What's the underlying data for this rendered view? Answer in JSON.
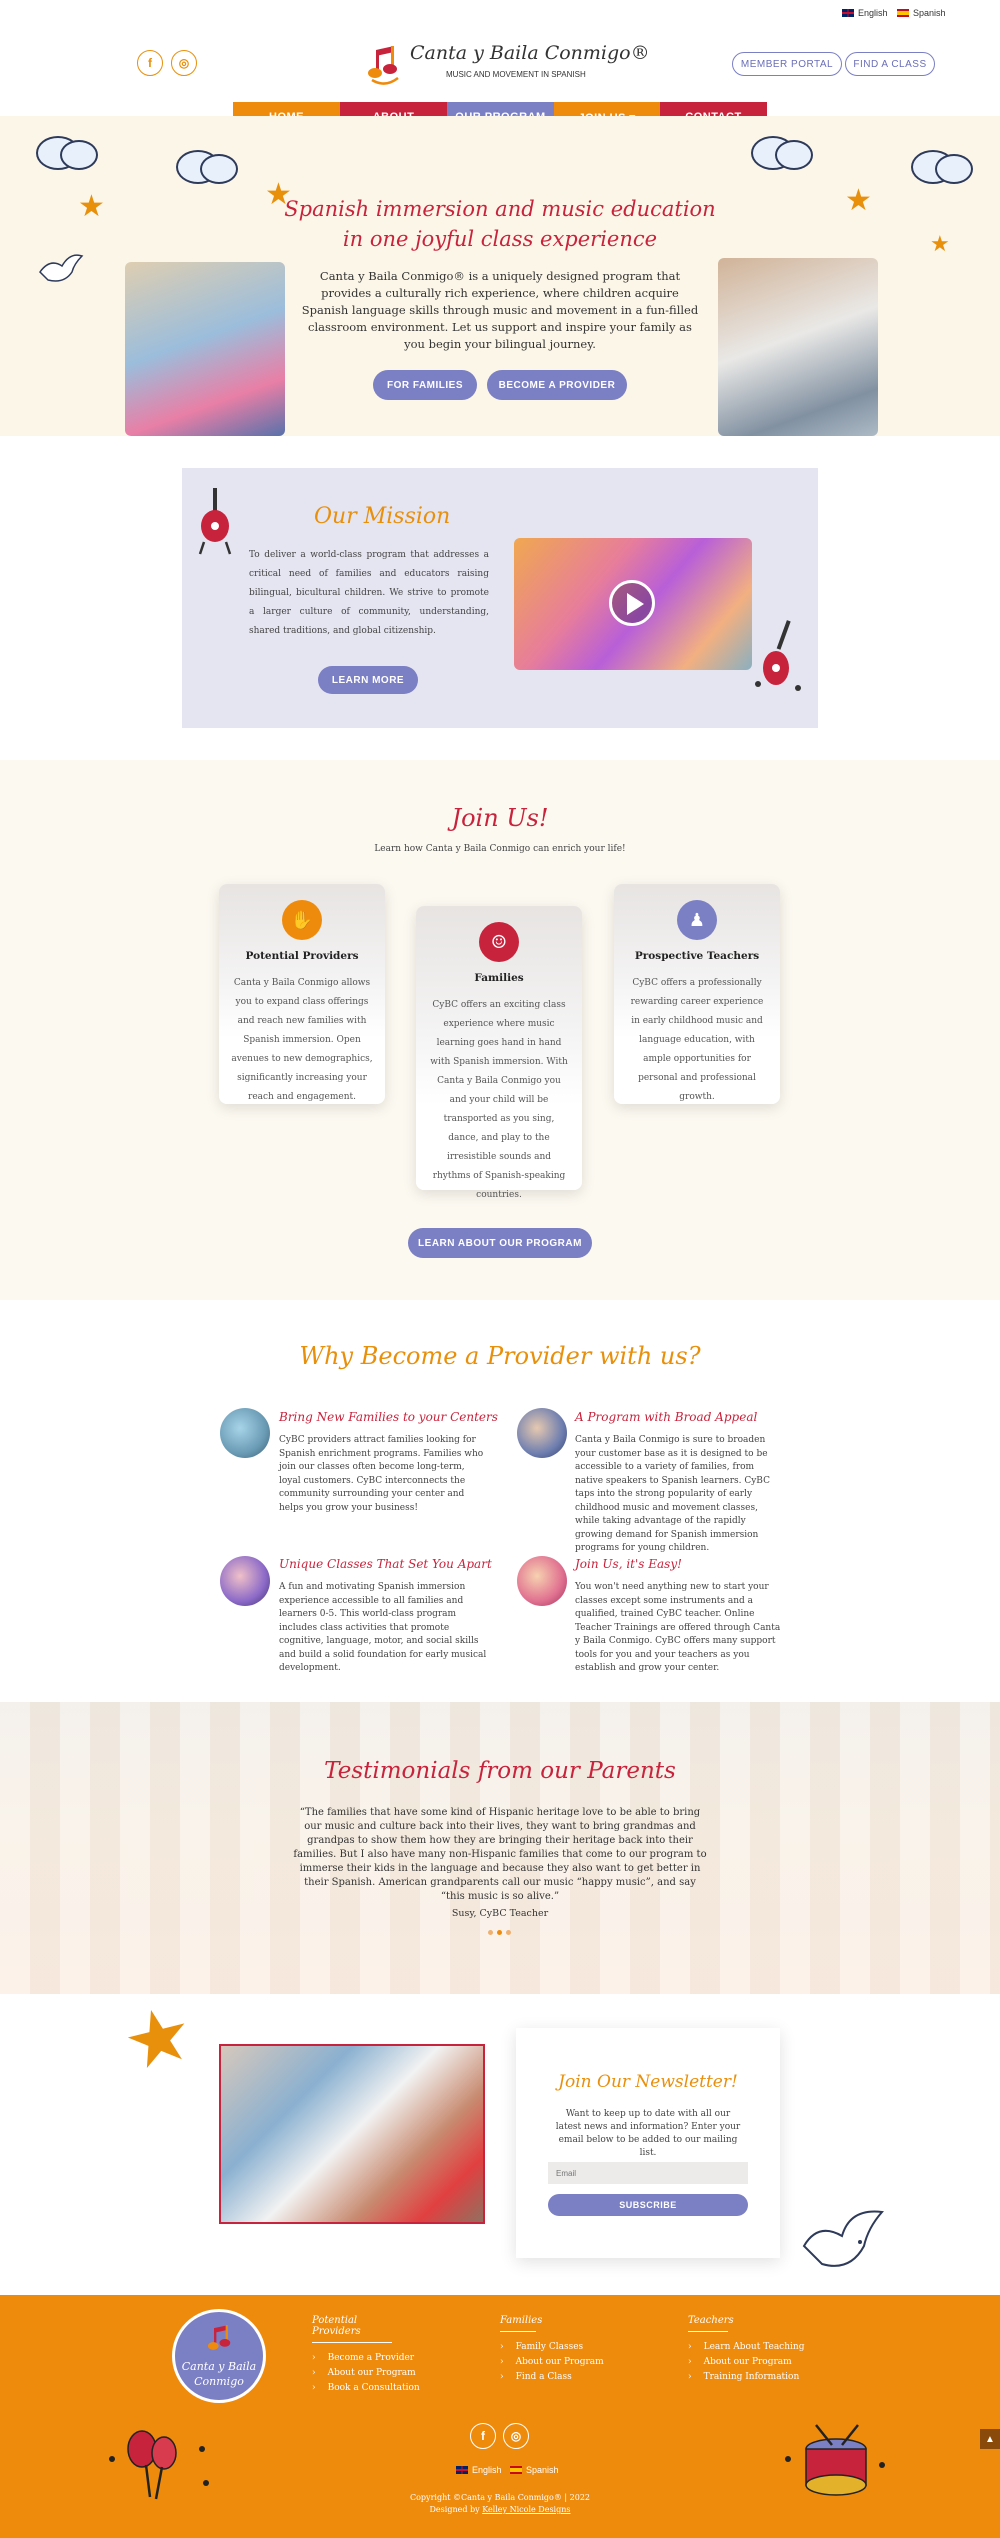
{
  "topbar": {
    "lang_en": "English",
    "lang_es": "Spanish"
  },
  "header": {
    "brand_name": "Canta y Baila Conmigo®",
    "tagline": "MUSIC AND MOVEMENT IN SPANISH",
    "member_portal": "MEMBER PORTAL",
    "find_class": "FIND A CLASS",
    "facebook_icon": "f",
    "instagram_icon": "◎"
  },
  "nav": [
    {
      "label": "HOME",
      "color": "#ef8b0c"
    },
    {
      "label": "ABOUT",
      "color": "#c8233c"
    },
    {
      "label": "OUR PROGRAM",
      "color": "#7b7fc4"
    },
    {
      "label": "JOIN US ▾",
      "color": "#ef8b0c"
    },
    {
      "label": "CONTACT",
      "color": "#c8233c"
    }
  ],
  "hero": {
    "title_line1": "Spanish immersion and music education",
    "title_line2": "in one joyful class experience",
    "body": "Canta y Baila Conmigo® is a uniquely designed program that provides a culturally rich experience, where children acquire Spanish language skills through music and movement in a fun-filled classroom environment. Let us support and inspire your family as you begin your bilingual journey.",
    "btn_families": "FOR FAMILIES",
    "btn_provider": "BECOME A PROVIDER"
  },
  "mission": {
    "title": "Our Mission",
    "body": "To deliver a world-class program that addresses a critical need of families and educators raising bilingual, bicultural children. We strive to promote a larger culture of community, understanding, shared traditions, and global citizenship.",
    "btn": "LEARN MORE"
  },
  "join": {
    "title": "Join Us!",
    "subtitle": "Learn how Canta y Baila Conmigo can enrich your life!",
    "cards": [
      {
        "title": "Potential Providers",
        "body": "Canta y Baila Conmigo allows you to expand class offerings and reach new families with Spanish immersion. Open avenues to new demographics, significantly increasing your reach and engagement."
      },
      {
        "title": "Families",
        "body": "CyBC offers an exciting class experience where music learning goes hand in hand with Spanish immersion. With Canta y Baila Conmigo you and your child will be transported as you sing, dance, and play to the irresistible sounds and rhythms of Spanish-speaking countries."
      },
      {
        "title": "Prospective Teachers",
        "body": "CyBC offers a professionally rewarding career experience in early childhood music and language education, with ample opportunities for personal and professional growth."
      }
    ],
    "btn": "LEARN ABOUT OUR PROGRAM"
  },
  "why": {
    "title": "Why Become a Provider with us?",
    "items": [
      {
        "title": "Bring New Families to your Centers",
        "body": "CyBC providers attract families looking for Spanish enrichment programs. Families who join our classes often become long-term, loyal customers. CyBC interconnects the community surrounding your center and helps you grow your business!"
      },
      {
        "title": "A Program with Broad Appeal",
        "body": "Canta y Baila Conmigo is sure to broaden your customer base as it is designed to be accessible to a variety of families, from native speakers to Spanish learners. CyBC taps into the strong popularity of early childhood music and movement classes, while taking advantage of the rapidly growing demand for Spanish immersion programs for young children."
      },
      {
        "title": "Unique Classes That Set You Apart",
        "body": "A fun and motivating Spanish immersion experience accessible to all families and learners 0-5. This world-class program includes class activities that promote cognitive, language, motor, and social skills and build a solid foundation for early musical development."
      },
      {
        "title": "Join Us, it's Easy!",
        "body": "You won't need anything new to start your classes except some instruments and a qualified, trained CyBC teacher. Online Teacher Trainings are offered through Canta y Baila Conmigo. CyBC offers many support tools for you and your teachers as you establish and grow your center."
      }
    ]
  },
  "testimonials": {
    "title": "Testimonials from our Parents",
    "quote": "“The families that have some kind of Hispanic heritage love to be able to bring our music and culture back into their lives, they want to bring grandmas and grandpas to show them how they are bringing their heritage back into their families. But I also have many non-Hispanic families that come to our program to immerse their kids in the language and because they also want to get better in their Spanish. American grandparents call our music “happy music”, and say “this music is so alive.”",
    "author": "Susy, CyBC Teacher"
  },
  "newsletter": {
    "title": "Join Our Newsletter!",
    "body": "Want to keep up to date with all our latest news and information? Enter your email below to be added to our mailing list.",
    "email_placeholder": "Email",
    "btn": "SUBSCRIBE"
  },
  "footer": {
    "logo_text_1": "Canta y Baila",
    "logo_text_2": "Conmigo",
    "columns": [
      {
        "title": "Potential Providers",
        "items": [
          "Become a Provider",
          "About our Program",
          "Book a Consultation"
        ]
      },
      {
        "title": "Families",
        "items": [
          "Family Classes",
          "About our Program",
          "Find a Class"
        ]
      },
      {
        "title": "Teachers",
        "items": [
          "Learn About Teaching",
          "About our Program",
          "Training Information"
        ]
      }
    ],
    "lang_en": "English",
    "lang_es": "Spanish",
    "copyright": "Copyright ©Canta y Baila Conmigo® | 2022",
    "designed_prefix": "Designed by",
    "designer": "Kelley Nicole Designs"
  },
  "colors": {
    "orange": "#ef8b0c",
    "red": "#c8233c",
    "purple": "#7b7fc4",
    "cream": "#fcf6e8"
  }
}
